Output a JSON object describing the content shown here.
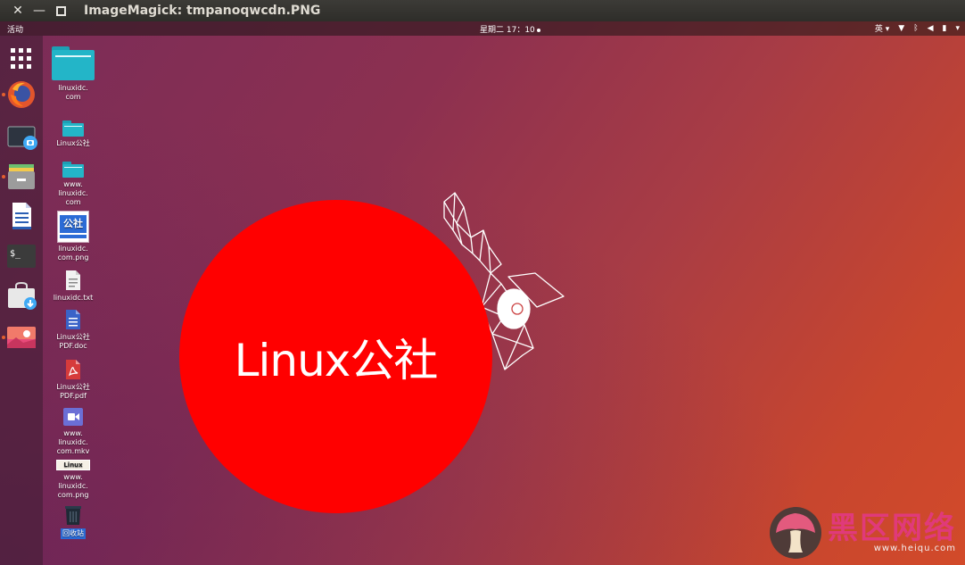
{
  "window": {
    "title": "ImageMagick: tmpanoqwcdn.PNG"
  },
  "topbar": {
    "activities": "活动",
    "clock": "星期二 17：10",
    "input_method": "英 ▾",
    "tray_icons": [
      "network-icon",
      "bluetooth-icon",
      "volume-icon",
      "battery-icon",
      "power-menu-icon"
    ]
  },
  "dock": {
    "items": [
      "apps-grid-icon",
      "firefox-icon",
      "screenshot-icon",
      "files-icon",
      "writer-icon",
      "terminal-icon",
      "software-icon",
      "image-viewer-icon"
    ]
  },
  "desktop": {
    "icons": [
      {
        "label": "linuxidc.\ncom",
        "type": "folder-large"
      },
      {
        "label": "Linux公社",
        "type": "folder"
      },
      {
        "label": "www.\nlinuxidc.\ncom",
        "type": "folder"
      },
      {
        "label": "linuxidc.\ncom.png",
        "type": "png",
        "thumb": "公社"
      },
      {
        "label": "linuxidc.txt",
        "type": "txt"
      },
      {
        "label": "Linux公社\nPDF.doc",
        "type": "doc"
      },
      {
        "label": "Linux公社\nPDF.pdf",
        "type": "pdf"
      },
      {
        "label": "www.\nlinuxidc.\ncom.mkv",
        "type": "video"
      },
      {
        "label": "www.\nlinuxidc.\ncom.png",
        "type": "png2",
        "thumb": "Linux"
      },
      {
        "label": "回收站",
        "type": "trash"
      }
    ]
  },
  "image": {
    "circle_text": "Linux公社",
    "circle_color": "#ff0000"
  },
  "watermark": {
    "cn": "黑区网络",
    "url": "www.heiqu.com"
  }
}
